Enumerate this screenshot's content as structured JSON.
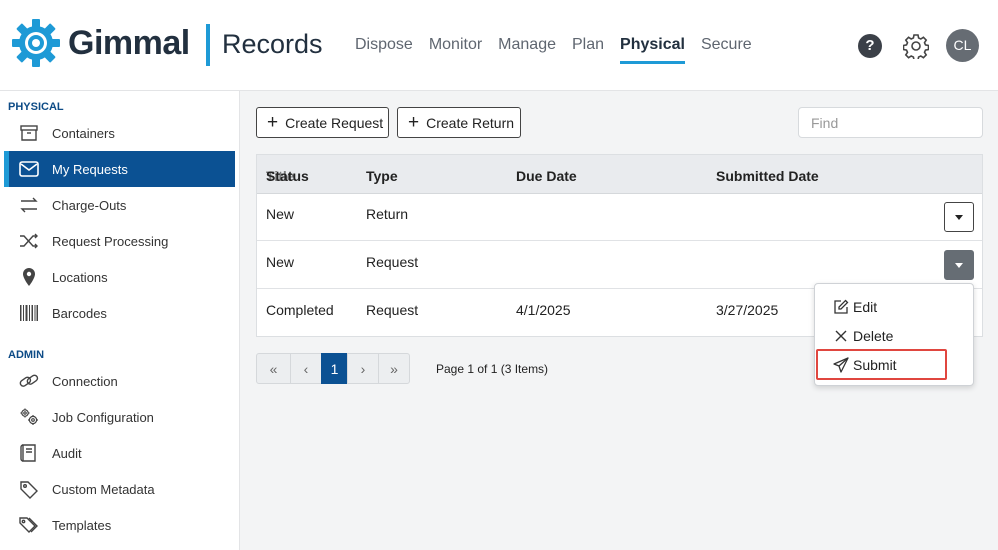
{
  "brand": {
    "name": "Gimmal",
    "product": "Records"
  },
  "nav": [
    {
      "label": "Dispose",
      "active": false
    },
    {
      "label": "Monitor",
      "active": false
    },
    {
      "label": "Manage",
      "active": false
    },
    {
      "label": "Plan",
      "active": false
    },
    {
      "label": "Physical",
      "active": true
    },
    {
      "label": "Secure",
      "active": false
    }
  ],
  "header": {
    "help_label": "?",
    "avatar_initials": "CL"
  },
  "sidebar": {
    "physical_title": "PHYSICAL",
    "physical_items": [
      {
        "label": "Containers",
        "icon": "archive-box-icon"
      },
      {
        "label": "My Requests",
        "icon": "envelope-icon",
        "active": true
      },
      {
        "label": "Charge-Outs",
        "icon": "swap-arrows-icon"
      },
      {
        "label": "Request Processing",
        "icon": "shuffle-icon"
      },
      {
        "label": "Locations",
        "icon": "map-pin-icon"
      },
      {
        "label": "Barcodes",
        "icon": "barcode-icon"
      }
    ],
    "admin_title": "ADMIN",
    "admin_items": [
      {
        "label": "Connection",
        "icon": "link-icon"
      },
      {
        "label": "Job Configuration",
        "icon": "gears-icon"
      },
      {
        "label": "Audit",
        "icon": "book-icon"
      },
      {
        "label": "Custom Metadata",
        "icon": "tag-icon"
      },
      {
        "label": "Templates",
        "icon": "tags-icon"
      }
    ]
  },
  "toolbar": {
    "create_request_label": "Create Request",
    "create_return_label": "Create Return",
    "find_placeholder": "Find"
  },
  "table": {
    "columns": [
      "Status",
      "Type",
      "Due Date",
      "Submitted Date"
    ],
    "overlap_header_text": "Title",
    "rows": [
      {
        "status": "New",
        "type": "Return",
        "due_date": "",
        "submitted_date": ""
      },
      {
        "status": "New",
        "type": "Request",
        "due_date": "",
        "submitted_date": ""
      },
      {
        "status": "Completed",
        "type": "Request",
        "due_date": "4/1/2025",
        "submitted_date": "3/27/2025"
      }
    ]
  },
  "row_menu": {
    "items": [
      {
        "label": "Edit",
        "icon": "edit-icon"
      },
      {
        "label": "Delete",
        "icon": "close-icon"
      },
      {
        "label": "Submit",
        "icon": "paper-plane-icon",
        "highlighted": true
      }
    ]
  },
  "pagination": {
    "current_page": "1",
    "info": "Page 1 of 1 (3 Items)",
    "first_symbol": "«",
    "prev_symbol": "‹",
    "next_symbol": "›",
    "last_symbol": "»"
  },
  "colors": {
    "accent": "#1e9ad6",
    "primary": "#0b5193",
    "highlight": "#e0463f"
  }
}
